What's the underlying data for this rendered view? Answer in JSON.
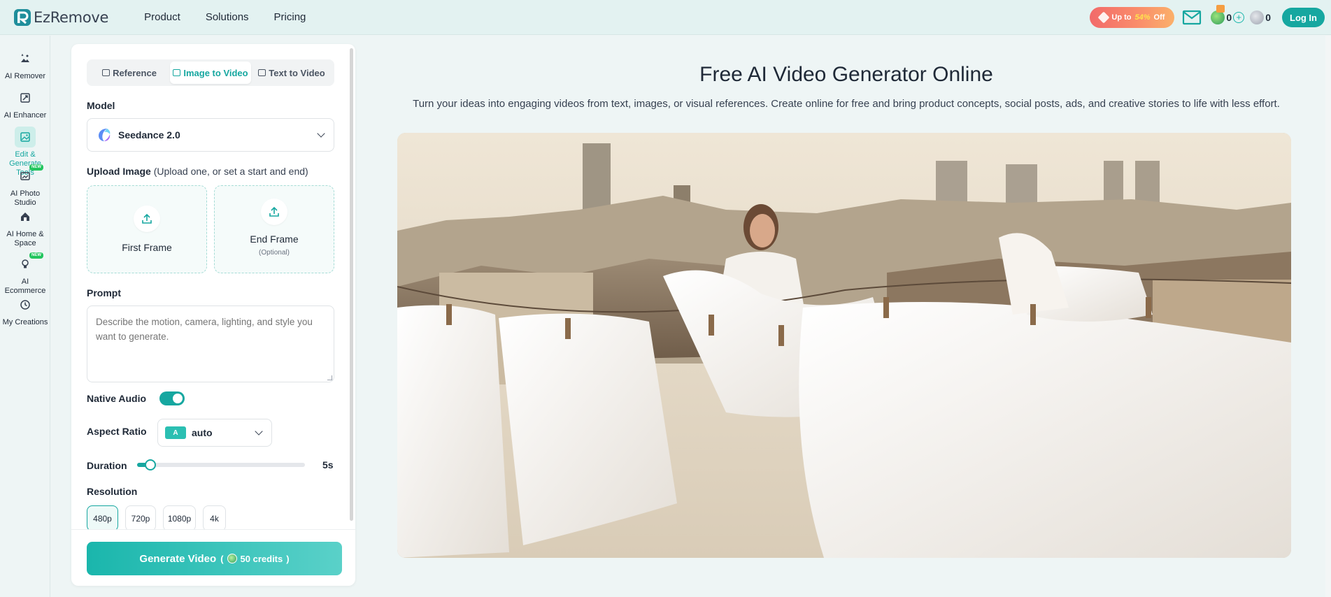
{
  "brand": {
    "name": "EzRemove"
  },
  "nav": [
    "Product",
    "Solutions",
    "Pricing"
  ],
  "header": {
    "promo": {
      "prefix": "Up to",
      "percent": "54%",
      "suffix": "Off"
    },
    "credits_primary": "0",
    "credits_secondary": "0",
    "login_label": "Log In"
  },
  "sidebar": {
    "items": [
      {
        "label": "AI Remover",
        "icon": "ai-remover-icon",
        "new": false,
        "active": false
      },
      {
        "label": "AI Enhancer",
        "icon": "ai-enhancer-icon",
        "new": false,
        "active": false
      },
      {
        "label": "Edit & Generate Tools",
        "icon": "image-icon",
        "new": false,
        "active": true
      },
      {
        "label": "AI Photo Studio",
        "icon": "photo-studio-icon",
        "new": true,
        "active": false
      },
      {
        "label": "AI Home & Space",
        "icon": "home-icon",
        "new": false,
        "active": false
      },
      {
        "label": "AI Ecommerce",
        "icon": "bulb-icon",
        "new": true,
        "active": false
      },
      {
        "label": "My Creations",
        "icon": "history-icon",
        "new": false,
        "active": false
      }
    ],
    "new_badge": "NEW"
  },
  "form": {
    "tabs": [
      {
        "label": "Reference",
        "active": false
      },
      {
        "label": "Image to Video",
        "active": true
      },
      {
        "label": "Text to Video",
        "active": false
      }
    ],
    "model_label": "Model",
    "model_value": "Seedance 2.0",
    "upload_label": "Upload Image",
    "upload_hint": "(Upload one, or set a start and end)",
    "first_frame": "First Frame",
    "end_frame": "End Frame",
    "end_frame_optional": "(Optional)",
    "prompt_label": "Prompt",
    "prompt_placeholder": "Describe the motion, camera, lighting, and style you want to generate.",
    "prompt_value": "",
    "native_audio_label": "Native Audio",
    "native_audio_on": true,
    "aspect_ratio_label": "Aspect Ratio",
    "aspect_ratio_chip": "A",
    "aspect_ratio_value": "auto",
    "duration_label": "Duration",
    "duration_value": "5s",
    "duration_fraction": 0.08,
    "resolution_label": "Resolution",
    "resolutions": [
      "480p",
      "720p",
      "1080p",
      "4k"
    ],
    "resolution_selected": "480p",
    "generate_label": "Generate Video",
    "generate_credits": "50 credits"
  },
  "main": {
    "title": "Free AI Video Generator Online",
    "subtitle": "Turn your ideas into engaging videos from text, images, or visual references. Create online for free and bring product concepts, social posts, ads, and creative stories to life with less effort."
  },
  "colors": {
    "accent": "#16a7a0",
    "promo_start": "#f26a6a",
    "promo_end": "#fbb06a"
  }
}
